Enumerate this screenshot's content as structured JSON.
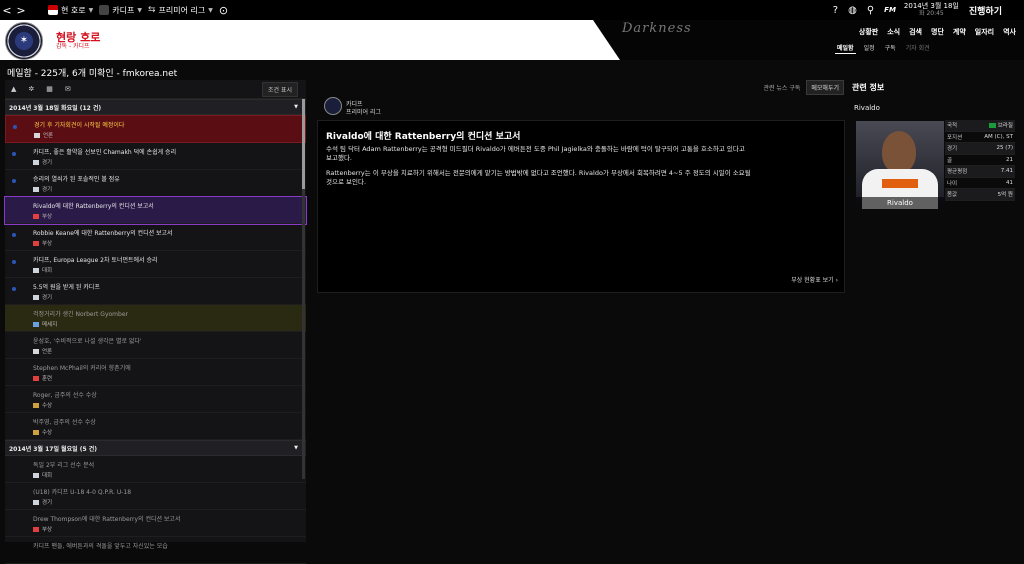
{
  "topbar": {
    "back": "<",
    "forward": ">",
    "club_selector": "현 호로",
    "team_selector": "카디프",
    "league_selector": "프리미어 리그",
    "fm_label": "FM",
    "date": "2014년 3월 18일",
    "time": "화 20:45",
    "continue": "진행하기"
  },
  "header": {
    "club_name": "현랑 호로",
    "club_role": "감독 - 카디프",
    "skin": "Darkness",
    "nav": [
      "상황판",
      "소식",
      "검색",
      "명단",
      "계약",
      "일자리",
      "역사"
    ],
    "subnav": [
      "메일함",
      "일정",
      "구독",
      "기자 회견"
    ]
  },
  "page_title": "메일함 - 225개, 6개 미확인 - fmkorea.net",
  "inbox": {
    "filter_btn": "조건 표시",
    "groups": [
      {
        "date": "2014년 3월 18일 화요일 (12 건)",
        "messages": [
          {
            "title": "경기 후 기자회견이 시작될 예정이다",
            "cat": "언론",
            "style": "red",
            "dot": "true"
          },
          {
            "title": "카디프, 좋은 활약을 선보인 Chamakh 덕에 손쉽게 승리",
            "cat": "경기",
            "style": "",
            "dot": "true"
          },
          {
            "title": "승리의 열쇠가 된 포솔적인 볼 점유",
            "cat": "경기",
            "style": "",
            "dot": "true"
          },
          {
            "title": "Rivaldo에 대한 Rattenberry의 컨디션 보고서",
            "cat": "부상",
            "style": "selected",
            "dot": "false"
          },
          {
            "title": "Robbie Keane에 대한 Rattenberry의 컨디션 보고서",
            "cat": "부상",
            "style": "",
            "dot": "true"
          },
          {
            "title": "카디프, Europa League 2차 토너먼트에서 승리",
            "cat": "대회",
            "style": "",
            "dot": "true"
          },
          {
            "title": "5.5억 원을 받게 된 카디프",
            "cat": "경기",
            "style": "",
            "dot": "true"
          },
          {
            "title": "걱정거리가 생긴 Norbert Gyomber",
            "cat": "메세지",
            "style": "olive read",
            "dot": "false"
          },
          {
            "title": "윤성호, '수비적으로 나설 생각은 별로 없다'",
            "cat": "언론",
            "style": "read",
            "dot": "false"
          },
          {
            "title": "Stephen McPhail의 커리어 향촌기에",
            "cat": "훈련",
            "style": "read",
            "dot": "false"
          },
          {
            "title": "Roger, 금주의 선수 수상",
            "cat": "수상",
            "style": "read",
            "dot": "false"
          },
          {
            "title": "박주영, 금주의 선수 수상",
            "cat": "수상",
            "style": "read",
            "dot": "false"
          }
        ]
      },
      {
        "date": "2014년 3월 17일 월요일 (5 건)",
        "messages": [
          {
            "title": "독일 2부 리그 선수 분석",
            "cat": "대회",
            "style": "read",
            "dot": "false"
          },
          {
            "title": "(U18) 카디프 U-18 4-0 Q.P.R. U-18",
            "cat": "경기",
            "style": "read",
            "dot": "false"
          },
          {
            "title": "Drew Thompson에 대한 Rattenberry의 컨디션 보고서",
            "cat": "부상",
            "style": "read",
            "dot": "false"
          },
          {
            "title": "카디프 팬들, 에버튼과의 격돌을 앞두고 자신있는 모습",
            "cat": "",
            "style": "read",
            "dot": "false"
          }
        ]
      }
    ]
  },
  "message": {
    "tab_subscribe": "관련 뉴스 구독",
    "tab_memo": "메모해두기",
    "sender_name": "카디프",
    "sender_league": "프리미어 리그",
    "heading": "Rivaldo에 대한 Rattenberry의 컨디션 보고서",
    "para1a": "수석 팀 닥터 Adam Rattenberry는 공격형 미드필더 Rivaldo가 에버튼전 도중 Phil Jagielka와 충돌하는 바람에 턱이 탈구되어 고통을 호소하고 있다고",
    "para1b": "보고했다.",
    "para2a": "Rattenberry는 이 부상을 치료하기 위해서는 전문의에게 맡기는 방법밖에 없다고 조언했다. Rivaldo가 부상에서 회복하려면 4~5 주 정도의 시일이 소요될",
    "para2b": "것으로 보인다.",
    "link": "부상 현황표 보기"
  },
  "related": {
    "title": "관련 정보",
    "player": "Rivaldo",
    "stats": [
      {
        "k": "국적",
        "v": "브라질"
      },
      {
        "k": "포지션",
        "v": "AM (C), ST"
      },
      {
        "k": "경기",
        "v": "25 (7)"
      },
      {
        "k": "골",
        "v": "21"
      },
      {
        "k": "평균평점",
        "v": "7.41"
      },
      {
        "k": "나이",
        "v": "41"
      },
      {
        "k": "몸값",
        "v": "5억 원"
      }
    ]
  }
}
